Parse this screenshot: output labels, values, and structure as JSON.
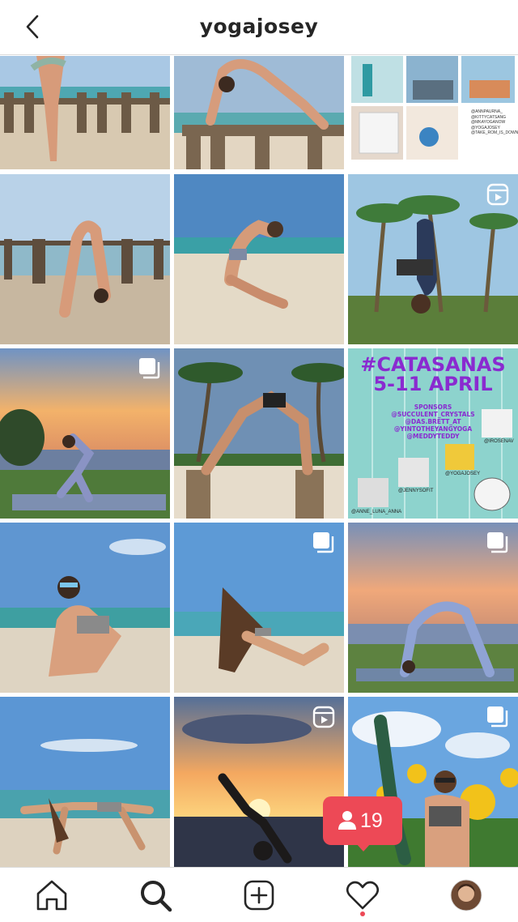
{
  "header": {
    "title": "yogajosey"
  },
  "poster": {
    "title_line1": "#CATASANAS",
    "title_line2": "5-11 APRIL",
    "sponsors_label": "SPONSORS",
    "sponsors": [
      "@SUCCULENT_CRYSTALS",
      "@DAS.BRETT_AT",
      "@YINTOTHEYANGYOGA",
      "@MEDDYTEDDY"
    ],
    "handles": [
      "@IROSENAV",
      "@YOGAJOSEY",
      "@JENNYSOFIT",
      "@ANNE_LUNA_ANNA"
    ]
  },
  "collage": {
    "handles": [
      "@ANNPAURNA_",
      "@KITTYCATSANG",
      "@MKAYOGANOW",
      "@YOGAJOSEY",
      "@TAKE_ROM_IS_DOWN"
    ]
  },
  "notification": {
    "count": "19",
    "color": "#ed4956"
  },
  "colors": {
    "accent": "#ed4956",
    "text": "#262626",
    "divider": "#dbdbdb"
  },
  "tiles": [
    {
      "name": "post-beach-handstand-pier",
      "badge": ""
    },
    {
      "name": "post-beach-wheel-pier",
      "badge": ""
    },
    {
      "name": "post-collage",
      "badge": ""
    },
    {
      "name": "post-beach-backbend-pier",
      "badge": ""
    },
    {
      "name": "post-beach-sand-backbend",
      "badge": ""
    },
    {
      "name": "post-palm-forearm-stand",
      "badge": "reel-icon"
    },
    {
      "name": "post-sunset-lunge",
      "badge": "carousel-icon"
    },
    {
      "name": "post-palm-posts-balance",
      "badge": ""
    },
    {
      "name": "post-catasanas-poster",
      "badge": ""
    },
    {
      "name": "post-beach-sunglasses-pose",
      "badge": ""
    },
    {
      "name": "post-beach-seated-backbend",
      "badge": "carousel-icon"
    },
    {
      "name": "post-mat-wheel",
      "badge": "carousel-icon"
    },
    {
      "name": "post-beach-crab-pose",
      "badge": ""
    },
    {
      "name": "post-sunset-headstand",
      "badge": "reel-icon"
    },
    {
      "name": "post-sunflower-leg-stretch",
      "badge": "carousel-icon"
    }
  ],
  "nav": [
    "home-icon",
    "search-icon",
    "add-post-icon",
    "heart-icon",
    "profile-avatar"
  ]
}
